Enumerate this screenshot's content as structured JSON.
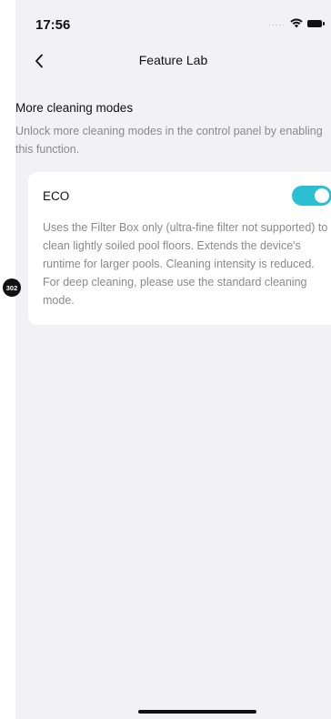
{
  "status_bar": {
    "time": "17:56",
    "signal": "....."
  },
  "nav": {
    "title": "Feature Lab"
  },
  "section": {
    "title": "More cleaning modes",
    "description": "Unlock more cleaning modes in the control panel by enabling this function."
  },
  "eco_card": {
    "title": "ECO",
    "toggle_on": true,
    "toggle_color": "#2bbfd4",
    "description": "Uses the Filter Box only (ultra-fine filter not supported) to clean lightly soiled pool floors. Extends the device's runtime for larger pools. Cleaning intensity is reduced. For deep cleaning, please use the standard cleaning mode."
  },
  "badge": {
    "label": "302"
  }
}
